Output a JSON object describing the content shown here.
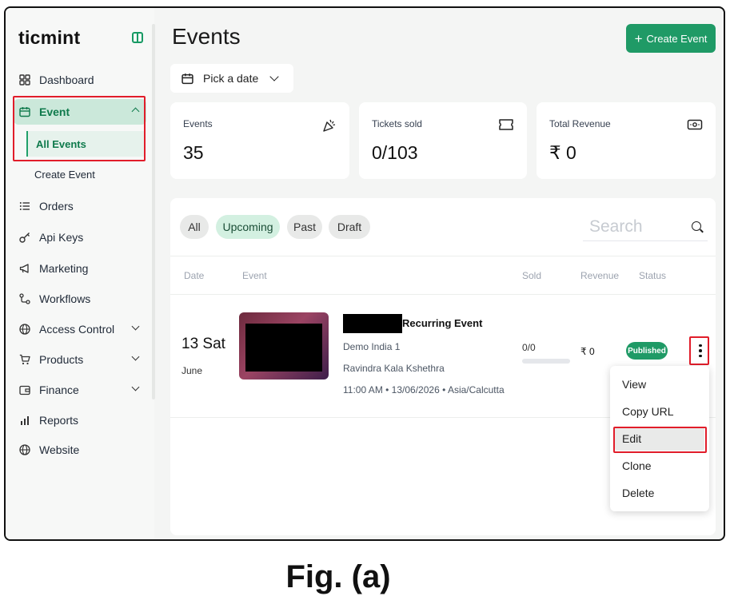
{
  "sidebar": {
    "logo": "ticmint",
    "items": [
      {
        "label": "Dashboard"
      },
      {
        "label": "Event"
      },
      {
        "label": "All Events"
      },
      {
        "label": "Create Event"
      },
      {
        "label": "Orders"
      },
      {
        "label": "Api Keys"
      },
      {
        "label": "Marketing"
      },
      {
        "label": "Workflows"
      },
      {
        "label": "Access Control"
      },
      {
        "label": "Products"
      },
      {
        "label": "Finance"
      },
      {
        "label": "Reports"
      },
      {
        "label": "Website"
      }
    ]
  },
  "header": {
    "title": "Events",
    "create_label": "Create Event",
    "date_picker_label": "Pick a date"
  },
  "stats": [
    {
      "label": "Events",
      "value": "35"
    },
    {
      "label": "Tickets sold",
      "value": "0/103"
    },
    {
      "label": "Total Revenue",
      "value": "₹ 0"
    }
  ],
  "tabs": [
    {
      "label": "All"
    },
    {
      "label": "Upcoming",
      "active": true
    },
    {
      "label": "Past"
    },
    {
      "label": "Draft"
    }
  ],
  "search": {
    "placeholder": "Search"
  },
  "table": {
    "headers": [
      "Date",
      "Event",
      "Sold",
      "Revenue",
      "Status"
    ],
    "rows": [
      {
        "date": "13 Sat",
        "month": "June",
        "title": "Recurring Event",
        "organizer": "Demo India 1",
        "venue": "Ravindra Kala Kshethra",
        "when": "11:00 AM • 13/06/2026 • Asia/Calcutta",
        "sold": "0/0",
        "sold_fraction": 0,
        "revenue": "₹ 0",
        "status": "Published"
      }
    ]
  },
  "row_menu": {
    "items": [
      {
        "label": "View"
      },
      {
        "label": "Copy URL"
      },
      {
        "label": "Edit"
      },
      {
        "label": "Clone"
      },
      {
        "label": "Delete"
      }
    ]
  },
  "caption": "Fig. (a)",
  "colors": {
    "accent": "#1f9a66",
    "highlight_box": "#e11d2a",
    "active_nav_bg": "#cbe8da"
  }
}
